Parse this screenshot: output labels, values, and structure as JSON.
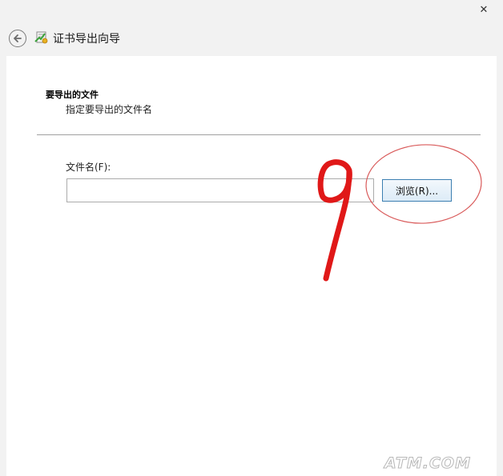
{
  "window": {
    "title": "证书导出向导",
    "close_label": "✕"
  },
  "section": {
    "heading": "要导出的文件",
    "description": "指定要导出的文件名"
  },
  "form": {
    "filename_label": "文件名(F):",
    "filename_value": "",
    "browse_label": "浏览(R)..."
  },
  "annotation": {
    "step_number": "9",
    "color": "#e01818",
    "circle_color": "#d95a5a"
  },
  "watermark": {
    "text": "ATM.COM"
  }
}
